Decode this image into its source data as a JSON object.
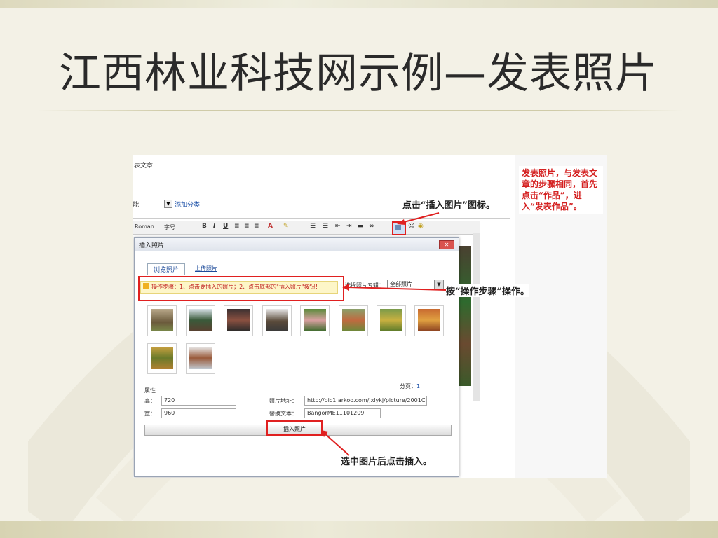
{
  "slide": {
    "title": "江西林业科技网示例—发表照片"
  },
  "editor": {
    "section_label": "表文章",
    "category_value": "能",
    "add_category_link": "添加分类",
    "font_name": "Roman",
    "font_size": "字号"
  },
  "dialog": {
    "title": "插入照片",
    "tabs": [
      "浏览照片",
      "上传照片"
    ],
    "step_text": "操作步骤：1、点击要插入的照片；2、点击底部的\"插入照片\"按钮！",
    "album_label": "选择照片专辑：",
    "album_selected": "全部照片",
    "pager_label": "分页：",
    "pager_page": "1",
    "attr_heading": "属性",
    "height_label": "高：",
    "height_value": "720",
    "width_label": "宽：",
    "width_value": "960",
    "url_label": "照片地址：",
    "url_value": "http://pic1.arkoo.com/jxlykj/picture/2001C",
    "alt_label": "替换文本：",
    "alt_value": "BangorME11101209",
    "insert_button": "插入照片"
  },
  "annotations": {
    "insert_icon_hint": "点击“插入图片”图标。",
    "steps_hint": "按“操作步骤”操作。",
    "insert_hint": "选中图片后点击插入。",
    "side_note": "发表照片，与发表文章的步骤相同，首先点击“作品”，进入“发表作品”。"
  }
}
